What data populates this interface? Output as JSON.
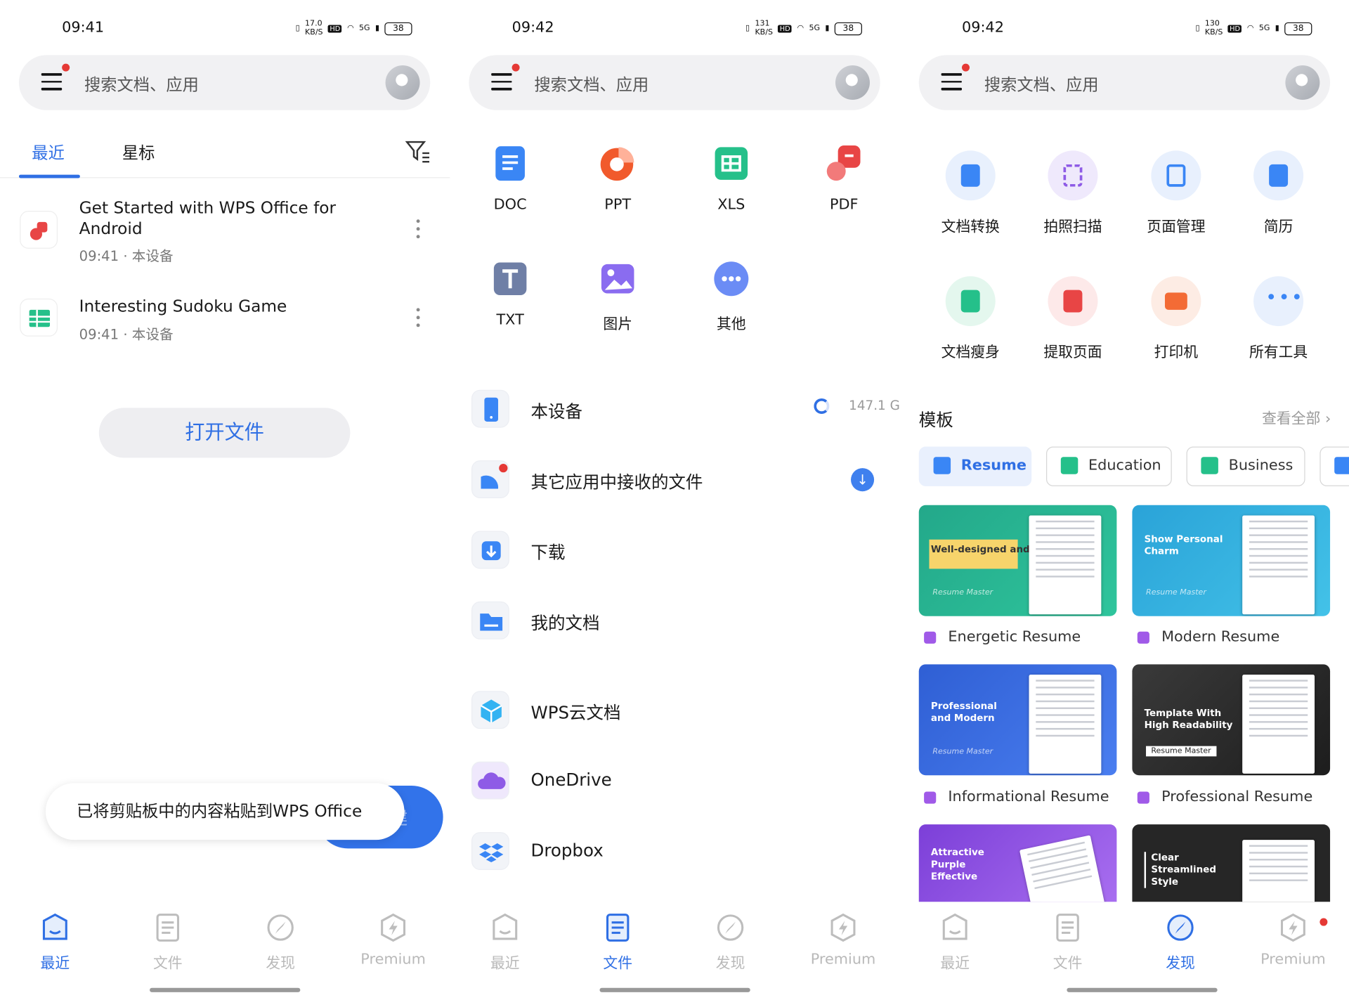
{
  "status_bars": [
    {
      "time": "09:41",
      "speed": "17.0",
      "speed_unit": "KB/S",
      "hd": "HD",
      "net": "5G",
      "battery": "38"
    },
    {
      "time": "09:42",
      "speed": "131",
      "speed_unit": "KB/S",
      "hd": "HD",
      "net": "5G",
      "battery": "38"
    },
    {
      "time": "09:42",
      "speed": "130",
      "speed_unit": "KB/S",
      "hd": "HD",
      "net": "5G",
      "battery": "38"
    }
  ],
  "search": {
    "placeholder": "搜索文档、应用"
  },
  "recent": {
    "tabs": [
      "最近",
      "星标"
    ],
    "files": [
      {
        "title": "Get Started with WPS Office for Android",
        "meta": "09:41 · 本设备"
      },
      {
        "title": "Interesting Sudoku Game",
        "meta": "09:41 · 本设备"
      }
    ],
    "open_button": "打开文件",
    "create_label": "创建",
    "toast": "已将剪贴板中的内容粘贴到WPS Office"
  },
  "files": {
    "types": [
      "DOC",
      "PPT",
      "XLS",
      "PDF",
      "TXT",
      "图片",
      "其他"
    ],
    "locations": [
      {
        "label": "本设备",
        "right": "147.1 G"
      },
      {
        "label": "其它应用中接收的文件"
      },
      {
        "label": "下载"
      },
      {
        "label": "我的文档"
      },
      {
        "label": "WPS云文档"
      },
      {
        "label": "OneDrive"
      },
      {
        "label": "Dropbox"
      }
    ]
  },
  "discover": {
    "tools": [
      "文档转换",
      "拍照扫描",
      "页面管理",
      "简历",
      "文档瘦身",
      "提取页面",
      "打印机",
      "所有工具"
    ],
    "section_title": "模板",
    "view_all": "查看全部",
    "chips": [
      "Resume",
      "Education",
      "Business"
    ],
    "cards": [
      {
        "tag": "Well-designed and energetic",
        "brand": "Resume Master",
        "label": "Energetic Resume"
      },
      {
        "tag": "Show Personal Charm",
        "brand": "Resume Master",
        "label": "Modern Resume"
      },
      {
        "tag": "Professional and Modern",
        "brand": "Resume Master",
        "label": "Informational Resume"
      },
      {
        "tag": "Template With High Readability",
        "brand": "Resume Master",
        "label": "Professional Resume"
      },
      {
        "tag": "Attractive Purple Effective"
      },
      {
        "tag": "Clear Streamlined Style"
      }
    ]
  },
  "nav": [
    "最近",
    "文件",
    "发现",
    "Premium"
  ],
  "colors": {
    "accent": "#2f6fe4",
    "doc": "#3a86f5",
    "ppt": "#f15a2c",
    "xls": "#25c08a",
    "pdf": "#e84545",
    "badge": "#e53935"
  }
}
